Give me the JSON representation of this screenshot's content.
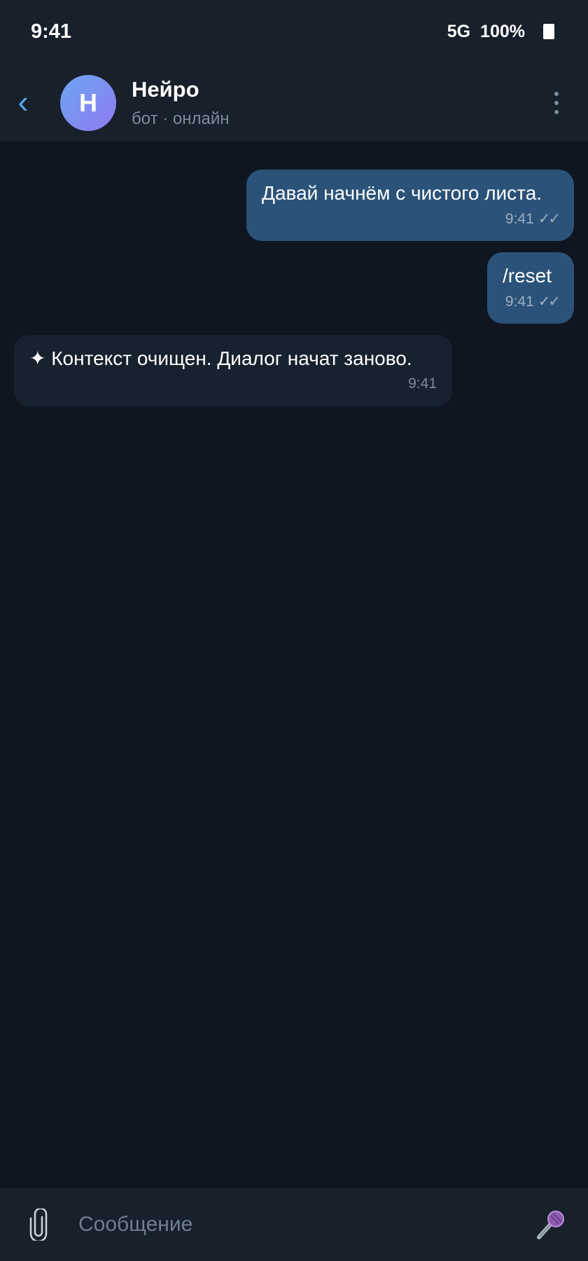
{
  "status_bar": {
    "time": "9:41",
    "network": "5G",
    "battery": "100%",
    "battery_icon": "battery-icon"
  },
  "header": {
    "back_icon": "chevron-left-icon",
    "back_glyph": "‹",
    "avatar_letter": "Н",
    "contact_name": "Нейро",
    "contact_status": "бот · онлайн",
    "more_icon": "more-vertical-icon",
    "accent_color": "#5aa2e8",
    "avatar_gradient": [
      "#6ba7f4",
      "#8f79ee"
    ]
  },
  "messages": [
    {
      "direction": "outgoing",
      "text": "Давай начнём с чистого листа.",
      "time": "9:41",
      "status_icon": "double-check-icon",
      "status_glyph": "✓✓"
    },
    {
      "direction": "outgoing",
      "text": "/reset",
      "time": "9:41",
      "status_icon": "double-check-icon",
      "status_glyph": "✓✓"
    },
    {
      "direction": "incoming",
      "text": "✦ Контекст очищен. Диалог начат заново.",
      "time": "9:41"
    }
  ],
  "composer": {
    "placeholder": "Сообщение",
    "value": "",
    "attach_icon": "paperclip-icon",
    "mic_icon": "microphone-icon"
  },
  "colors": {
    "background": "#0f1621",
    "bar_background": "#17202b",
    "outgoing_bubble": "#2b5278",
    "incoming_bubble": "#18222e"
  }
}
